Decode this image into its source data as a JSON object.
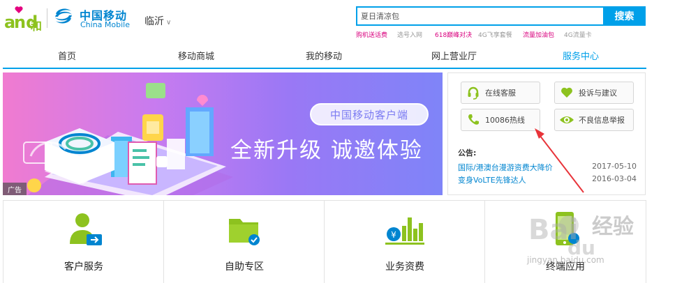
{
  "header": {
    "and_logo": {
      "a": "a",
      "nd": "nd",
      "he": "和"
    },
    "brand_cn": "中国移动",
    "brand_en": "China Mobile",
    "city": "临沂"
  },
  "search": {
    "value": "夏日清凉包",
    "button_label": "搜索",
    "hot_links": [
      {
        "label": "购机送话费",
        "color": "#d9007e"
      },
      {
        "label": "选号入网",
        "color": "#999999"
      },
      {
        "label": "618巅峰对决",
        "color": "#d9007e"
      },
      {
        "label": "4G飞享套餐",
        "color": "#999999"
      },
      {
        "label": "流量加油包",
        "color": "#d9007e"
      },
      {
        "label": "4G流量卡",
        "color": "#999999"
      }
    ]
  },
  "nav": {
    "items": [
      {
        "label": "首页"
      },
      {
        "label": "移动商城"
      },
      {
        "label": "我的移动"
      },
      {
        "label": "网上营业厅"
      },
      {
        "label": "服务中心",
        "active": true
      }
    ],
    "accent": "#00a0e9"
  },
  "banner": {
    "pill": "中国移动客户端",
    "slogan": "全新升级 诚邀体验",
    "ad_tag": "广告"
  },
  "service_panel": {
    "buttons": [
      {
        "label": "在线客服",
        "icon": "headset-icon",
        "color": "#8dc21f"
      },
      {
        "label": "投诉与建议",
        "icon": "heart-icon",
        "color": "#8dc21f"
      },
      {
        "label": "10086热线",
        "icon": "phone-icon",
        "color": "#8dc21f"
      },
      {
        "label": "不良信息举报",
        "icon": "eye-icon",
        "color": "#8dc21f"
      }
    ],
    "notice_title": "公告:",
    "notices": [
      {
        "title": "国际/港澳台漫游资费大降价",
        "date": "2017-05-10"
      },
      {
        "title": "变身VoLTE先锋达人",
        "date": "2016-03-04"
      }
    ]
  },
  "tiles": [
    {
      "label": "客户服务",
      "icon": "customer-service-icon"
    },
    {
      "label": "自助专区",
      "icon": "folder-check-icon"
    },
    {
      "label": "业务资费",
      "icon": "tariff-chart-icon"
    },
    {
      "label": "终端应用",
      "icon": "mobile-terminal-icon"
    }
  ],
  "watermark": {
    "brand": "经验",
    "url": "jingyan.baidu.com"
  }
}
